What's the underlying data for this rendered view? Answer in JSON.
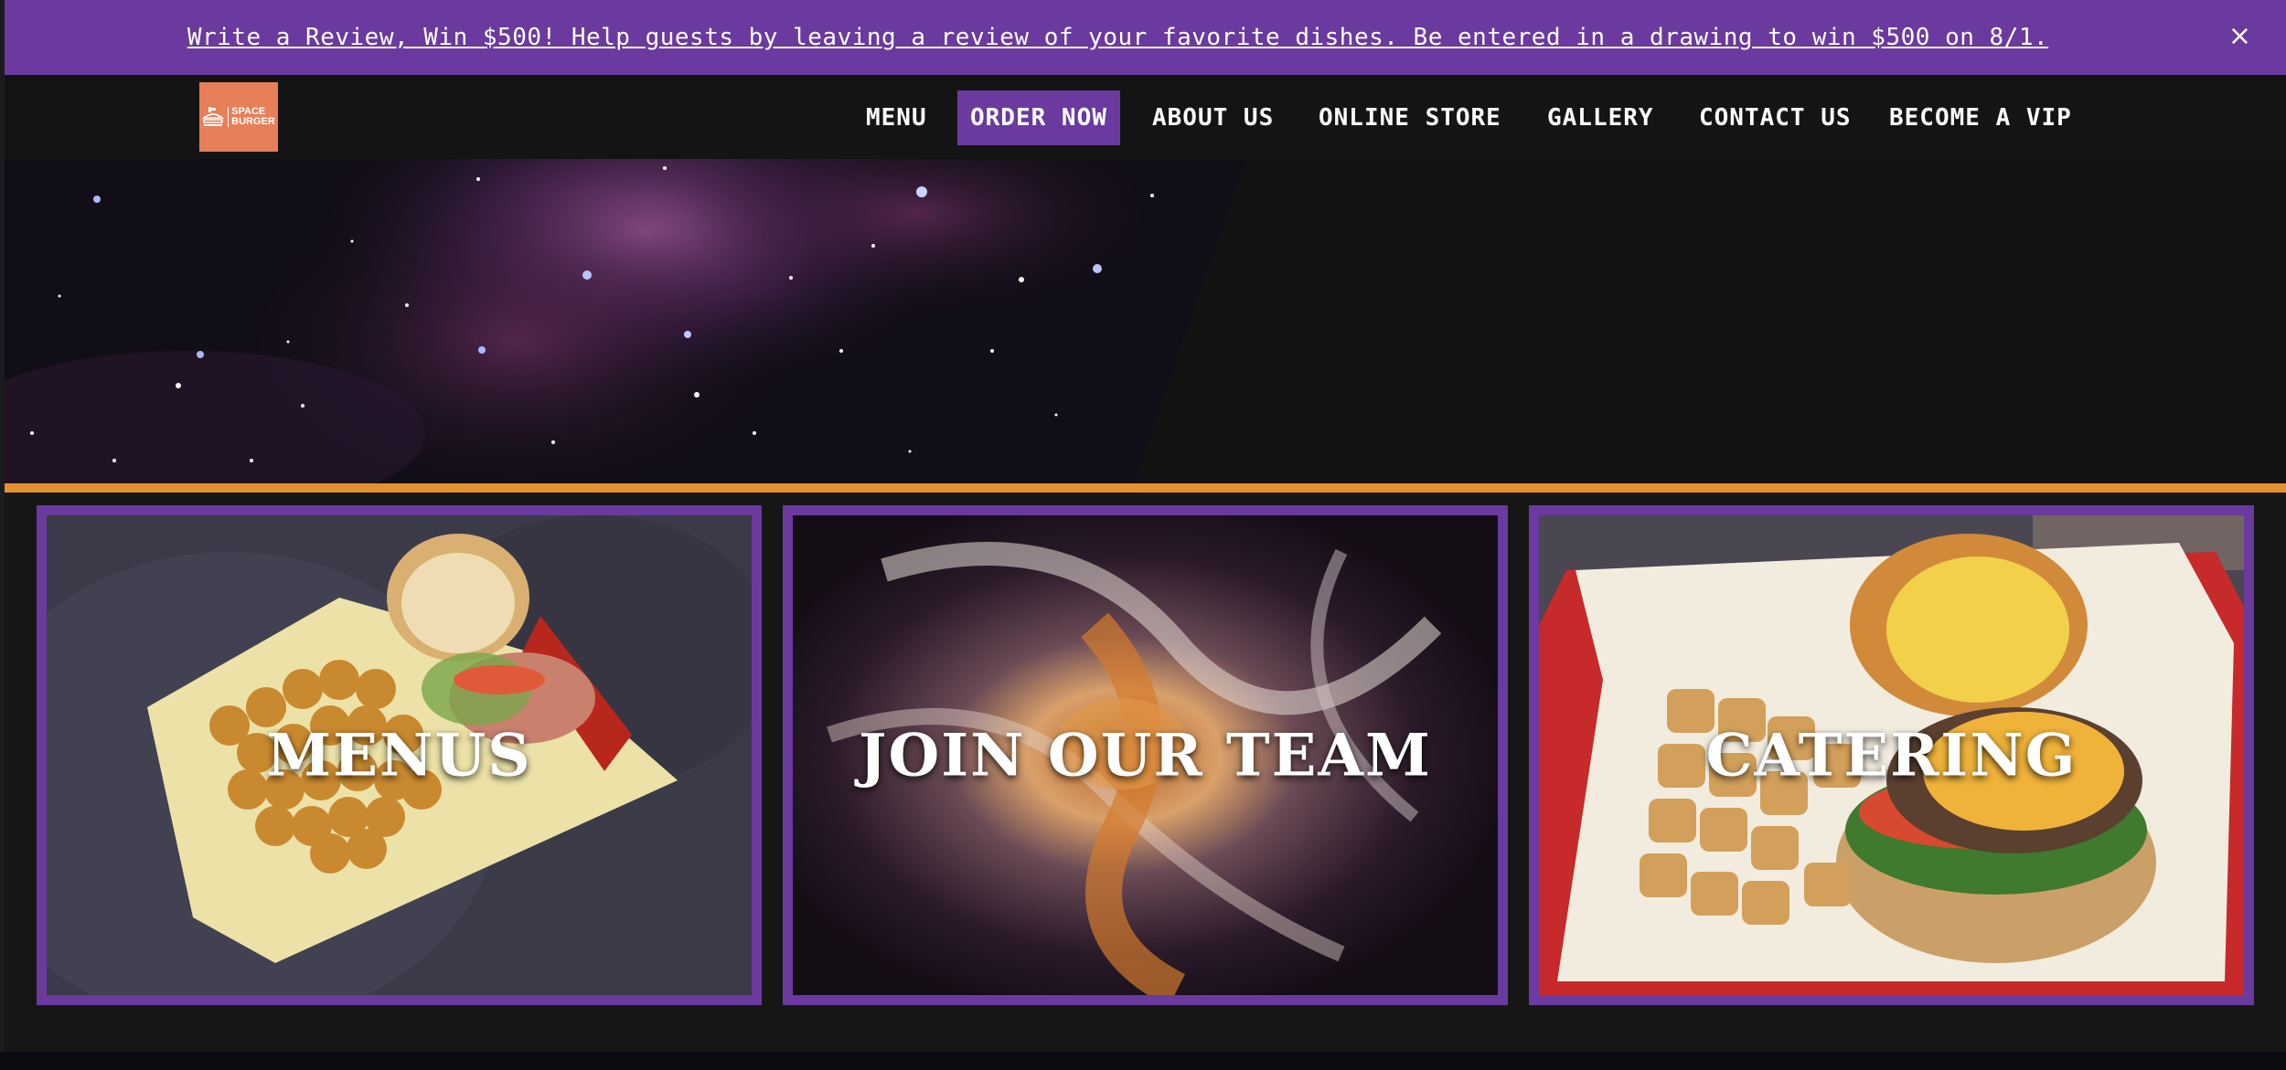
{
  "announcement": {
    "text": "Write a Review, Win $500! Help guests by leaving a review of your favorite dishes. Be entered in a drawing to win $500 on 8/1.",
    "close_label": "×",
    "background": "#6a3a9e"
  },
  "logo": {
    "line1": "SPACE",
    "line2": "BURGER",
    "background": "#e77f58"
  },
  "nav": {
    "items": [
      {
        "label": "MENU"
      },
      {
        "label": "ORDER NOW",
        "active": true
      },
      {
        "label": "ABOUT US"
      },
      {
        "label": "ONLINE STORE"
      },
      {
        "label": "GALLERY"
      },
      {
        "label": "CONTACT US"
      },
      {
        "label": "BECOME A VIP"
      }
    ]
  },
  "accent_colors": {
    "purple": "#6a3a9e",
    "orange_bar": "#e5922e"
  },
  "cards": [
    {
      "label": "MENUS",
      "image": "tater-tots-sandwich-photo"
    },
    {
      "label": "JOIN OUR TEAM",
      "image": "cosmic-swirl-photo"
    },
    {
      "label": "CATERING",
      "image": "burger-and-tots-photo"
    }
  ]
}
